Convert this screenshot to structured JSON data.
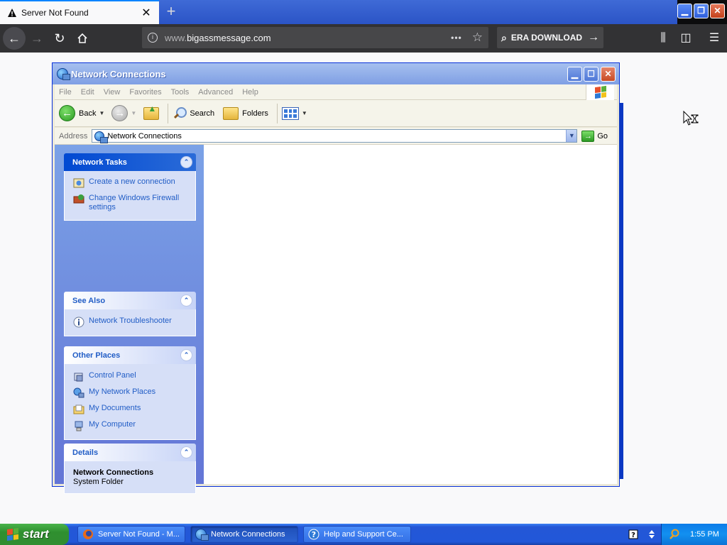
{
  "browser": {
    "tab_title": "Server Not Found",
    "tab_close": "✕",
    "new_tab": "+",
    "url_prefix": "www.",
    "url_domain": "bigassmessage.com",
    "url_more": "•••",
    "search_text": "ERA DOWNLOAD"
  },
  "window": {
    "title": "Network Connections",
    "menu": [
      "File",
      "Edit",
      "View",
      "Favorites",
      "Tools",
      "Advanced",
      "Help"
    ],
    "toolbar": {
      "back": "Back",
      "search": "Search",
      "folders": "Folders"
    },
    "address": {
      "label": "Address",
      "value": "Network Connections",
      "go": "Go"
    }
  },
  "panels": {
    "network_tasks": {
      "title": "Network Tasks",
      "items": [
        "Create a new connection",
        "Change Windows Firewall settings"
      ]
    },
    "see_also": {
      "title": "See Also",
      "items": [
        "Network Troubleshooter"
      ]
    },
    "other_places": {
      "title": "Other Places",
      "items": [
        "Control Panel",
        "My Network Places",
        "My Documents",
        "My Computer"
      ]
    },
    "details": {
      "title": "Details",
      "name": "Network Connections",
      "type": "System Folder"
    }
  },
  "taskbar": {
    "start": "start",
    "tasks": [
      "Server Not Found - M...",
      "Network Connections",
      "Help and Support Ce..."
    ],
    "clock": "1:55 PM"
  },
  "colors": {
    "xp_blue": "#215dc6",
    "firefox_dark": "#323234",
    "start_green": "#318e31"
  }
}
